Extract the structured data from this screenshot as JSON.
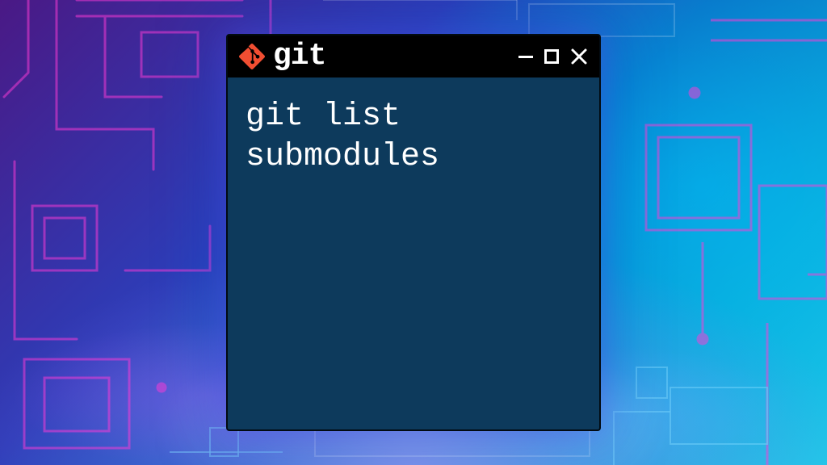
{
  "window": {
    "title": "git",
    "logo_color": "#f14e32"
  },
  "terminal": {
    "content": "git list submodules",
    "bg_color": "#0d3a5c",
    "fg_color": "#ffffff"
  }
}
